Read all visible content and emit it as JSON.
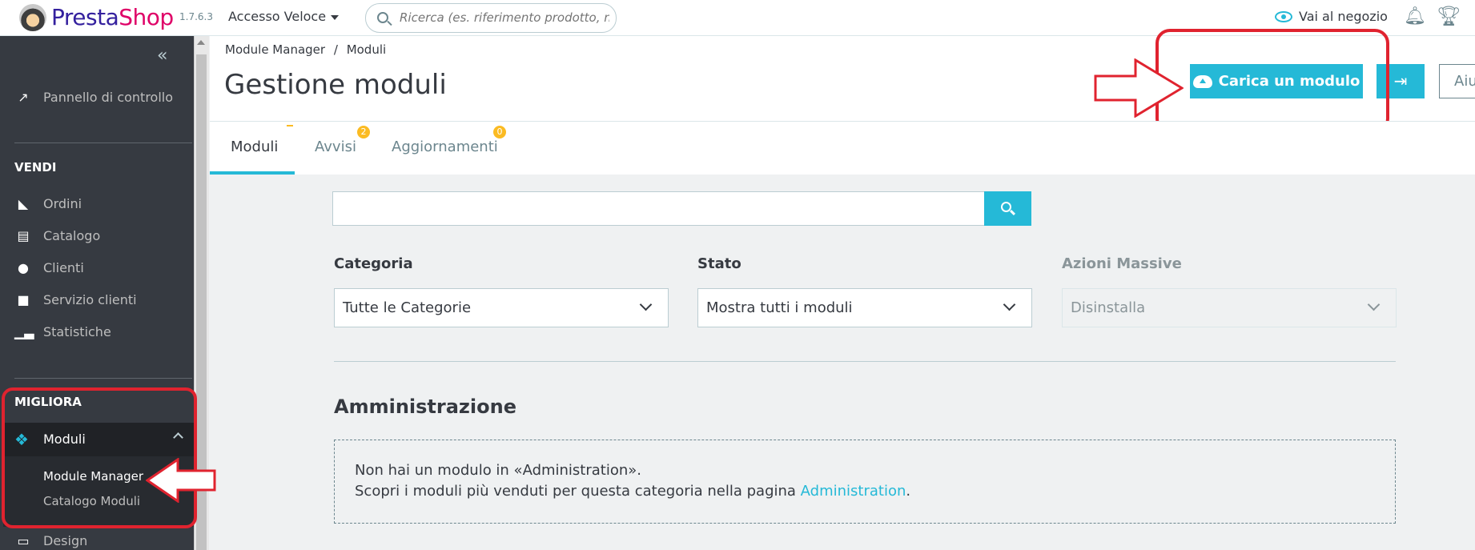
{
  "header": {
    "brand_presta": "Presta",
    "brand_shop": "Shop",
    "version": "1.7.6.3",
    "quick_access": "Accesso Veloce",
    "search_placeholder": "Ricerca (es. riferimento prodotto, nome",
    "view_shop": "Vai al negozio"
  },
  "sidebar": {
    "dashboard": "Pannello di controllo",
    "section_sell": "VENDI",
    "sell_items": [
      "Ordini",
      "Catalogo",
      "Clienti",
      "Servizio clienti",
      "Statistiche"
    ],
    "section_improve": "MIGLIORA",
    "modules": "Moduli",
    "sub_items": [
      "Module Manager",
      "Catalogo Moduli"
    ],
    "design": "Design"
  },
  "page": {
    "breadcrumb_parent": "Module Manager",
    "breadcrumb_sep": "/",
    "breadcrumb_current": "Moduli",
    "title": "Gestione moduli",
    "upload_button": "Carica un modulo",
    "help_button": "Aiu"
  },
  "tabs": [
    {
      "label": "Moduli"
    },
    {
      "label": "Avvisi",
      "badge": "2"
    },
    {
      "label": "Aggiornamenti",
      "badge": "0"
    }
  ],
  "filters": {
    "category_label": "Categoria",
    "category_value": "Tutte le Categorie",
    "status_label": "Stato",
    "status_value": "Mostra tutti i moduli",
    "bulk_label": "Azioni Massive",
    "bulk_value": "Disinstalla"
  },
  "section": {
    "title": "Amministrazione",
    "empty_line1": "Non hai un modulo in «Administration».",
    "empty_line2_prefix": "Scopri i moduli più venduti per questa categoria nella pagina ",
    "empty_link": "Administration",
    "empty_line2_suffix": "."
  },
  "colors": {
    "accent": "#25b9d7",
    "sidebar": "#363a41",
    "annotation": "#e0232f",
    "badge": "#fbbb22"
  }
}
